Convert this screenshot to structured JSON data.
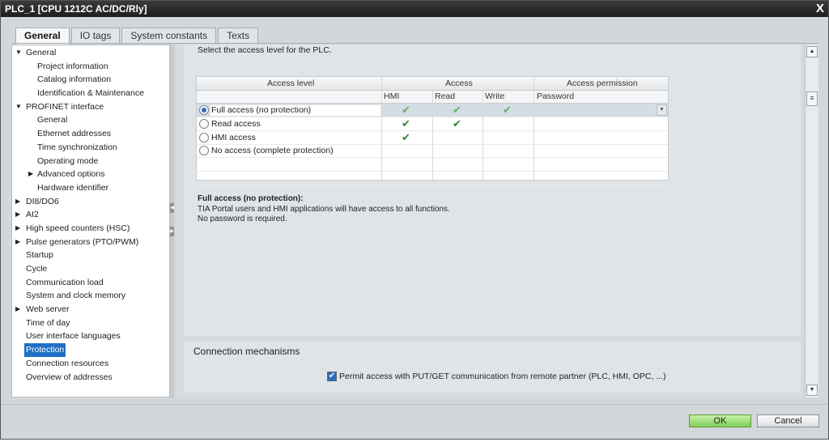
{
  "window": {
    "title": "PLC_1 [CPU 1212C AC/DC/Rly]",
    "close_glyph": "X"
  },
  "tabs": [
    "General",
    "IO tags",
    "System constants",
    "Texts"
  ],
  "tree": {
    "items": [
      {
        "label": "General",
        "expander": "▼"
      },
      {
        "label": "Project information",
        "expander": ""
      },
      {
        "label": "Catalog information",
        "expander": ""
      },
      {
        "label": "Identification & Maintenance",
        "expander": ""
      },
      {
        "label": "PROFINET interface",
        "expander": "▼"
      },
      {
        "label": "General",
        "expander": ""
      },
      {
        "label": "Ethernet addresses",
        "expander": ""
      },
      {
        "label": "Time synchronization",
        "expander": ""
      },
      {
        "label": "Operating mode",
        "expander": ""
      },
      {
        "label": "Advanced options",
        "expander": "▶"
      },
      {
        "label": "Hardware identifier",
        "expander": ""
      },
      {
        "label": "DI8/DO6",
        "expander": "▶"
      },
      {
        "label": "AI2",
        "expander": "▶"
      },
      {
        "label": "High speed counters (HSC)",
        "expander": "▶"
      },
      {
        "label": "Pulse generators (PTO/PWM)",
        "expander": "▶"
      },
      {
        "label": "Startup",
        "expander": ""
      },
      {
        "label": "Cycle",
        "expander": ""
      },
      {
        "label": "Communication load",
        "expander": ""
      },
      {
        "label": "System and clock memory",
        "expander": ""
      },
      {
        "label": "Web server",
        "expander": "▶"
      },
      {
        "label": "Time of day",
        "expander": ""
      },
      {
        "label": "User interface languages",
        "expander": ""
      },
      {
        "label": "Protection",
        "expander": "",
        "selected": true
      },
      {
        "label": "Connection resources",
        "expander": ""
      },
      {
        "label": "Overview of addresses",
        "expander": ""
      }
    ]
  },
  "protection": {
    "instruction": "Select the access level for the PLC.",
    "table": {
      "group_headers": {
        "level": "Access level",
        "access": "Access",
        "permission": "Access permission"
      },
      "sub_headers": {
        "hmi": "HMI",
        "read": "Read",
        "write": "Write",
        "password": "Password"
      },
      "rows": [
        {
          "label": "Full access (no protection)",
          "checked": true,
          "hmi": "✔",
          "read": "✔",
          "write": "✔"
        },
        {
          "label": "Read access",
          "checked": false,
          "hmi": "✔",
          "read": "✔",
          "write": ""
        },
        {
          "label": "HMI access",
          "checked": false,
          "hmi": "✔",
          "read": "",
          "write": ""
        },
        {
          "label": "No access (complete protection)",
          "checked": false,
          "hmi": "",
          "read": "",
          "write": ""
        }
      ]
    },
    "description": {
      "title": "Full access (no protection):",
      "line1": "TIA Portal users and HMI applications will have access to all functions.",
      "line2": "No password is required."
    }
  },
  "connection": {
    "title": "Connection mechanisms",
    "putget_label": "Permit access with PUT/GET communication from remote partner (PLC, HMI, OPC, ...)",
    "putget_checked": true
  },
  "footer": {
    "ok": "OK",
    "cancel": "Cancel"
  },
  "icons": {
    "check": "✔",
    "dropdown": "▼",
    "scroll_up": "▲",
    "scroll_down": "▼",
    "scroll_grip": "≡",
    "collapse": "◀",
    "expand": "▶"
  },
  "colors": {
    "selection": "#1f6fc5",
    "ok_button": "#7fcf57",
    "check": "#2e8b2e"
  }
}
